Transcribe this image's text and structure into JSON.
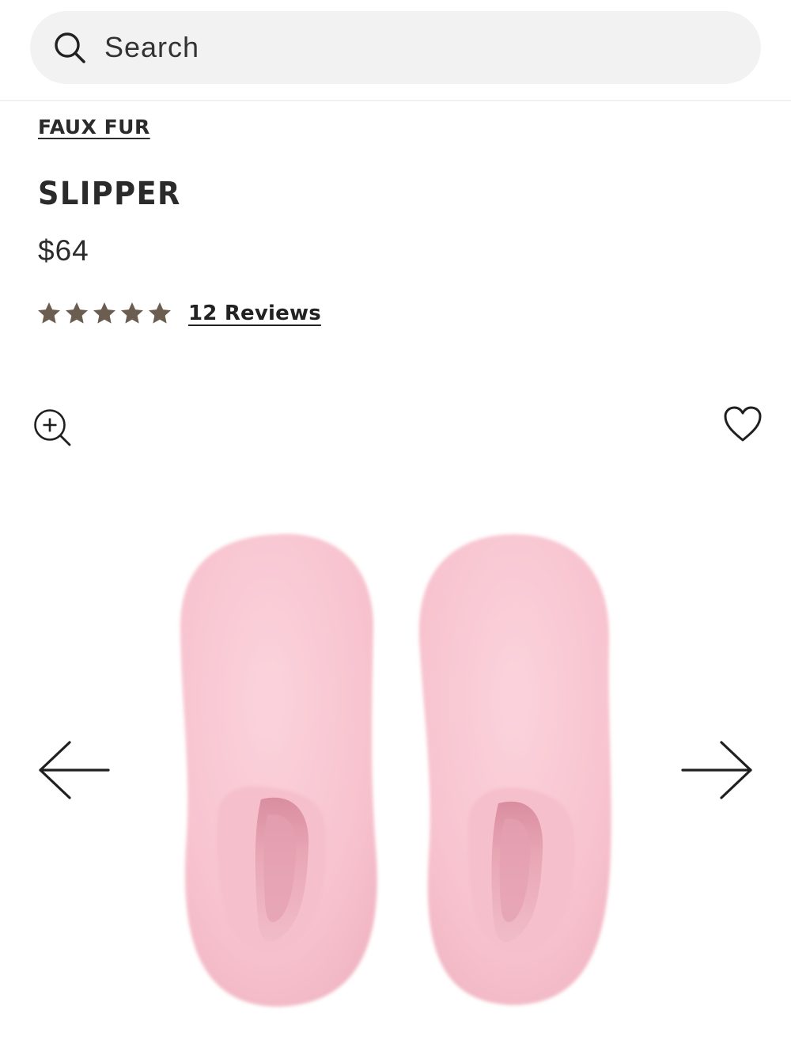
{
  "search": {
    "placeholder": "Search",
    "icon": "search-icon"
  },
  "product": {
    "collection": "FAUX FUR",
    "title": "SLIPPER",
    "price": "$64",
    "rating": 5,
    "rating_max": 5,
    "reviews_label": "12 Reviews",
    "color": "#f7c3cf"
  },
  "gallery": {
    "zoom_icon": "zoom-in-icon",
    "wishlist_icon": "heart-icon",
    "prev_icon": "arrow-left-icon",
    "next_icon": "arrow-right-icon"
  },
  "colors": {
    "text": "#2b2b2b",
    "star": "#6b5d4f",
    "search_bg": "#f2f2f2"
  }
}
